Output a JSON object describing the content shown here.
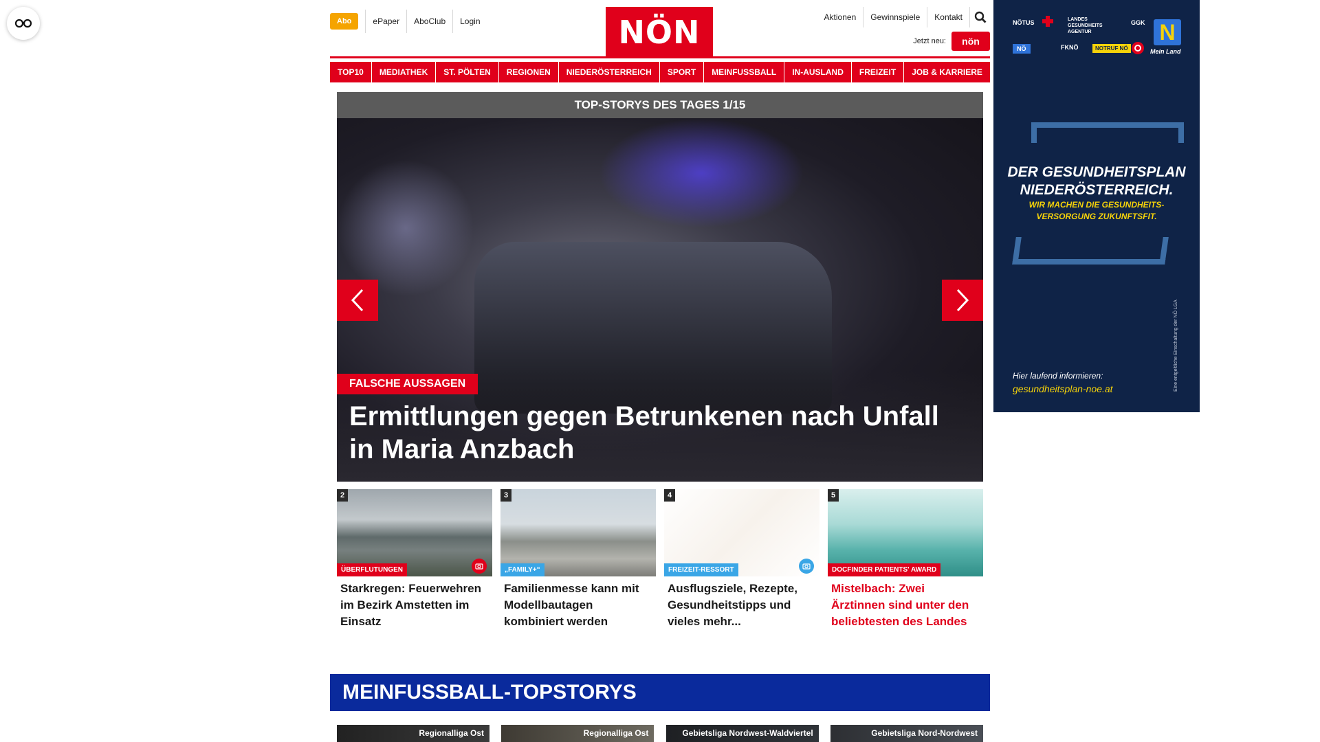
{
  "header": {
    "abo": "Abo",
    "left_links": [
      "ePaper",
      "AboClub",
      "Login"
    ],
    "logo": "NÖN",
    "right_links": [
      "Aktionen",
      "Gewinnspiele",
      "Kontakt"
    ],
    "jetzt_neu": "Jetzt neu:",
    "mini_logo": "nön"
  },
  "nav": [
    "TOP10",
    "MEDIATHEK",
    "ST. PÖLTEN",
    "REGIONEN",
    "NIEDERÖSTERREICH",
    "SPORT",
    "MEINFUSSBALL",
    "IN-AUSLAND",
    "FREIZEIT",
    "JOB & KARRIERE"
  ],
  "slider": {
    "heading": "TOP-STORYS DES TAGES 1/15",
    "kicker": "FALSCHE AUSSAGEN",
    "headline": "Ermittlungen gegen Betrunkenen nach Unfall in Maria Anzbach"
  },
  "cards": [
    {
      "num": "2",
      "tag": "ÜBERFLUTUNGEN",
      "title": "Starkregen: Feuerwehren im Bezirk Amstetten im Einsatz"
    },
    {
      "num": "3",
      "tag": "„FAMILY+“",
      "title": "Familienmesse kann mit Modellbautagen kombiniert werden"
    },
    {
      "num": "4",
      "tag": "FREIZEIT-RESSORT",
      "title": "Ausflugsziele, Rezepte, Gesundheitstipps und vieles mehr..."
    },
    {
      "num": "5",
      "tag": "DOCFINDER PATIENTS' AWARD",
      "title": "Mistelbach: Zwei Ärztinnen sind unter den beliebtesten des Landes"
    }
  ],
  "section": {
    "title": "MEINFUSSBALL-TOPSTORYS",
    "cards": [
      "Regionalliga Ost",
      "Regionalliga Ost",
      "Gebietsliga Nordwest-Waldviertel",
      "Gebietsliga Nord-Nordwest"
    ]
  },
  "ad": {
    "logos": [
      "NÖTUS",
      "LANDES GESUNDHEITS AGENTUR",
      "GGK",
      "NÖ",
      "FKNÖ",
      "NOTRUF NÖ"
    ],
    "n_logo": "N",
    "mein_land": "Mein Land",
    "headline_1": "DER GESUNDHEITSPLAN",
    "headline_2": "NIEDERÖSTERREICH.",
    "sub_1": "WIR MACHEN DIE GESUNDHEITS-",
    "sub_2": "VERSORGUNG ZUKUNFTSFIT.",
    "info": "Hier laufend informieren:",
    "url": "gesundheitsplan-noe.at",
    "vertical": "Eine entgeltliche Einschaltung der NÖ LGA"
  },
  "colors": {
    "brand_red": "#e0001b",
    "abo_orange": "#f5a400",
    "section_blue": "#0a2a9c",
    "ad_navy": "#0f2347",
    "ad_yellow": "#f5d20a"
  }
}
